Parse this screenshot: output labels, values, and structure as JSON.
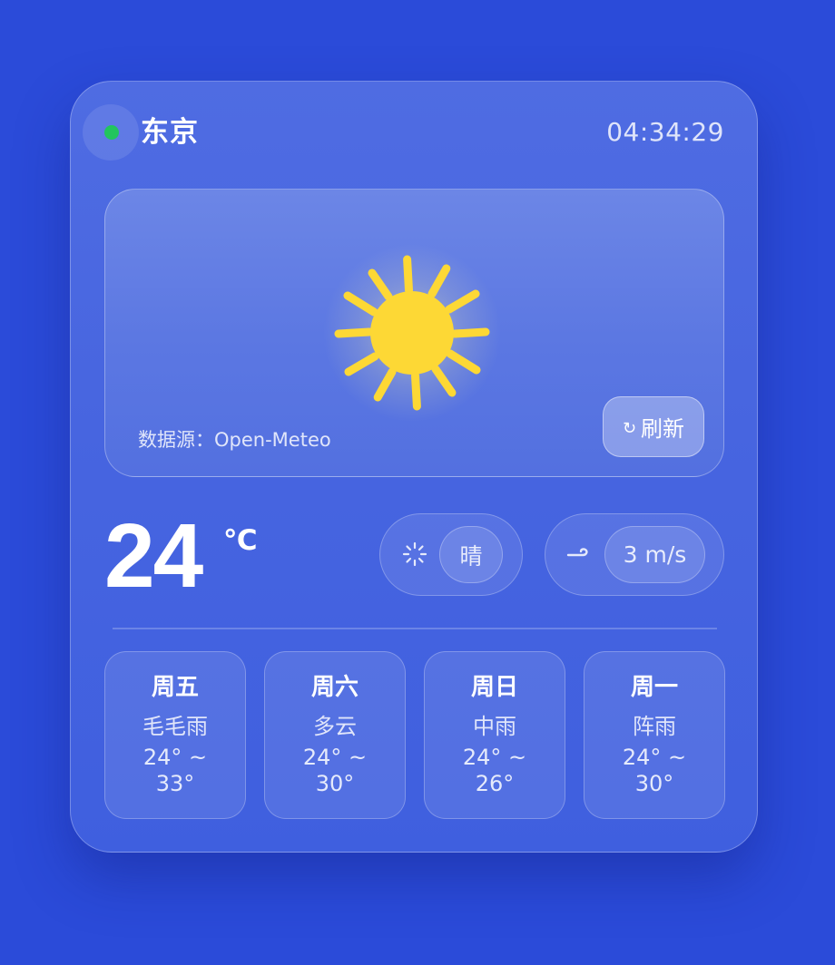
{
  "header": {
    "status": "online",
    "status_color": "#22c55e",
    "city": "东京",
    "time": "04:34:29"
  },
  "hero": {
    "icon": "sun-icon",
    "sun_color": "#fdd835",
    "source": "数据源：Open-Meteo",
    "refresh_label": "刷新",
    "refresh_icon": "↻"
  },
  "current": {
    "temperature": "24",
    "unit": "℃",
    "condition": "晴",
    "condition_icon": "sun-outline-icon",
    "wind": "3 m/s",
    "wind_icon": "wind-icon"
  },
  "forecast": [
    {
      "day": "周五",
      "condition": "毛毛雨",
      "low": "24° ~",
      "high": "33°"
    },
    {
      "day": "周六",
      "condition": "多云",
      "low": "24° ~",
      "high": "30°"
    },
    {
      "day": "周日",
      "condition": "中雨",
      "low": "24° ~",
      "high": "26°"
    },
    {
      "day": "周一",
      "condition": "阵雨",
      "low": "24° ~",
      "high": "30°"
    }
  ]
}
